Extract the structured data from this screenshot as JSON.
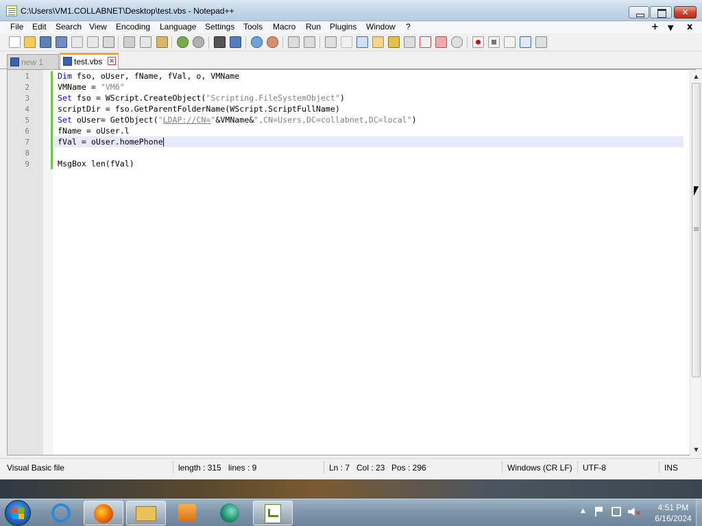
{
  "window": {
    "title": "C:\\Users\\VM1.COLLABNET\\Desktop\\test.vbs - Notepad++"
  },
  "menu": {
    "items": [
      "File",
      "Edit",
      "Search",
      "View",
      "Encoding",
      "Language",
      "Settings",
      "Tools",
      "Macro",
      "Run",
      "Plugins",
      "Window",
      "?"
    ],
    "right_plus": "+",
    "right_down": "▼",
    "right_x": "x"
  },
  "tabs": [
    {
      "label": "new 1",
      "active": false
    },
    {
      "label": "test.vbs",
      "active": true
    }
  ],
  "editor": {
    "line_numbers": [
      "1",
      "2",
      "3",
      "4",
      "5",
      "6",
      "7",
      "8",
      "9"
    ],
    "lines": {
      "l1_kw": "Dim",
      "l1_rest": " fso, oUser, fName, fVal, o, VMName",
      "l2_a": "VMName = ",
      "l2_str": "\"VM6\"",
      "l3_kw": "Set",
      "l3_a": " fso = WScript.CreateObject(",
      "l3_str": "\"Scripting.FileSystemObject\"",
      "l3_b": ")",
      "l4": "scriptDir = fso.GetParentFolderName(WScript.ScriptFullName)",
      "l5_kw": "Set",
      "l5_a": " oUser= GetObject(",
      "l5_q": "\"",
      "l5_link": "LDAP://CN=",
      "l5_q2": "\"",
      "l5_b": "&VMName&",
      "l5_str": "\",CN=Users,DC=collabnet,DC=local\"",
      "l5_c": ")",
      "l6": "fName = oUser.l",
      "l7": "fVal = oUser.homePhone",
      "l8": "",
      "l9": "MsgBox len(fVal)"
    }
  },
  "status": {
    "file_type": "Visual Basic file",
    "length": "length : 315",
    "lines": "lines : 9",
    "ln": "Ln : 7",
    "col": "Col : 23",
    "pos": "Pos : 296",
    "eol": "Windows (CR LF)",
    "encoding": "UTF-8",
    "mode": "INS"
  },
  "taskbar": {
    "apps": [
      "internet-explorer",
      "firefox",
      "file-explorer",
      "media-player",
      "edge-app",
      "notepad-plus-plus"
    ],
    "clock_time": "4:51 PM",
    "clock_date": "6/16/2024"
  },
  "colors": {
    "keyword": "#0000ff",
    "string": "#808080",
    "caret_line": "#e8e8ff",
    "change_bar": "#6cc24a",
    "tab_accent": "#f4a31b"
  }
}
